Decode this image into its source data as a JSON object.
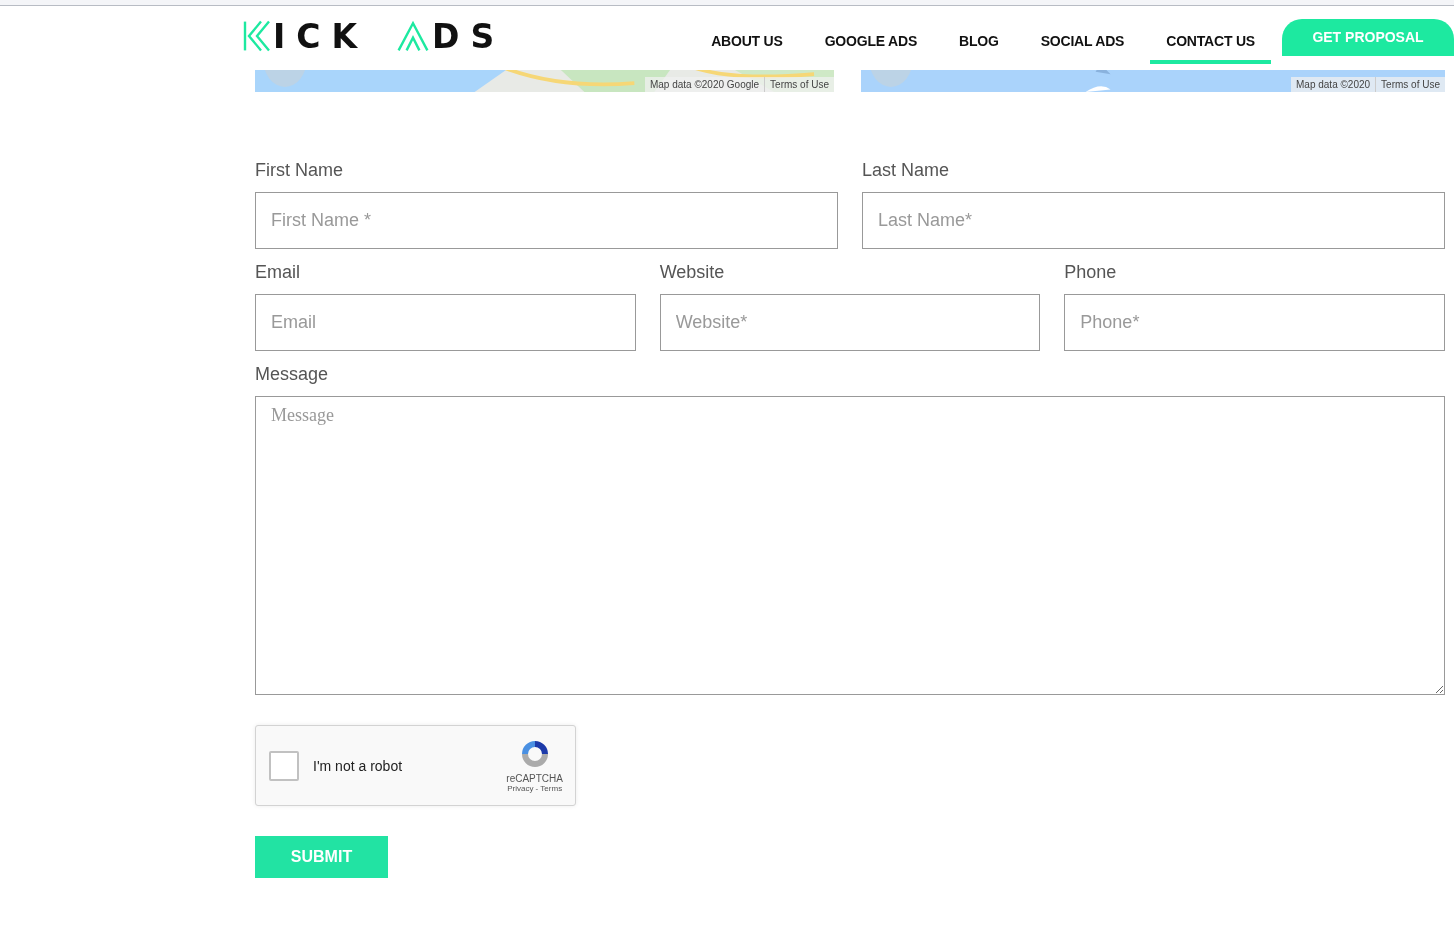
{
  "header": {
    "logo": {
      "first": "ICK",
      "second": "DS"
    },
    "nav": [
      {
        "label": "ABOUT US",
        "selected": false
      },
      {
        "label": "GOOGLE ADS",
        "selected": false
      },
      {
        "label": "BLOG",
        "selected": false
      },
      {
        "label": "SOCIAL ADS",
        "selected": false
      },
      {
        "label": "CONTACT US",
        "selected": true
      }
    ],
    "cta": "GET PROPOSAL"
  },
  "maps": [
    {
      "kind": "land",
      "attribution": [
        "Map data ©2020 Google",
        "Terms of Use"
      ]
    },
    {
      "kind": "sea",
      "attribution": [
        "Map data ©2020",
        "Terms of Use"
      ]
    }
  ],
  "form": {
    "rows": [
      [
        {
          "label": "First Name",
          "placeholder": "First Name *"
        },
        {
          "label": "Last Name",
          "placeholder": "Last Name*"
        }
      ],
      [
        {
          "label": "Email",
          "placeholder": "Email"
        },
        {
          "label": "Website",
          "placeholder": "Website*"
        },
        {
          "label": "Phone",
          "placeholder": "Phone*"
        }
      ]
    ],
    "message": {
      "label": "Message",
      "placeholder": "Message"
    },
    "captcha": {
      "label": "I'm not a robot",
      "checked": false,
      "brand": "reCAPTCHA",
      "links": "Privacy - Terms"
    },
    "submit": "SUBMIT"
  }
}
